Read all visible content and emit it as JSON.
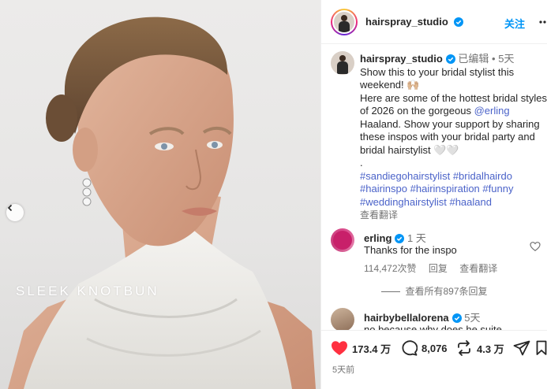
{
  "post": {
    "overlay_text": "SLEEK KNOTBUN"
  },
  "header": {
    "username": "hairspray_studio",
    "follow_label": "关注"
  },
  "caption": {
    "username": "hairspray_studio",
    "edited": "已编辑",
    "separator": "•",
    "time": "5天",
    "line1": "Show this to your bridal stylist this weekend! 🙌🏼",
    "line2a": "Here are some of the hottest bridal styles of 2026 on the gorgeous ",
    "mention": "@erling",
    "line2b": " Haaland. Show your support by sharing these inspos with your bridal party and bridal hairstylist 🤍🤍",
    "dot": ".",
    "hashtags": [
      "#sandiegohairstylist",
      "#bridalhairdo",
      "#hairinspo",
      "#hairinspiration",
      "#funny",
      "#weddinghairstylist",
      "#haaland"
    ],
    "see_translation": "查看翻译"
  },
  "comments": [
    {
      "username": "erling",
      "time": "1 天",
      "text": "Thanks for the inspo",
      "likes": "114,472次赞",
      "reply": "回复",
      "see_translation": "查看翻译"
    },
    {
      "username": "hairbybellalorena",
      "time": "5天",
      "text": "no because why does he suite"
    }
  ],
  "view_all": "查看所有897条回复",
  "actions": {
    "likes": "173.4 万",
    "comments": "8,076",
    "reposts": "4.3 万",
    "posted_ago": "5天前"
  },
  "colors": {
    "accent_blue": "#0095f6",
    "heart_red": "#ff3040",
    "hashtag": "#4b63c9",
    "verified": "#0095f6"
  }
}
